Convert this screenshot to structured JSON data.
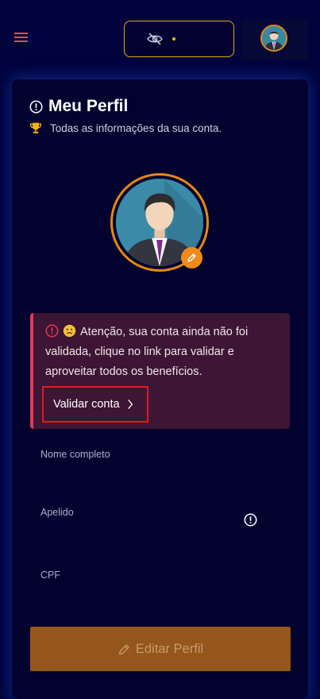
{
  "header": {
    "menu_icon": "hamburger-menu-icon",
    "balance_visibility_icon": "eye-slash-icon",
    "balance_hidden_value": "•",
    "avatar_icon": "user-avatar-icon"
  },
  "profile": {
    "title_icon": "info-circle-icon",
    "title": "Meu Perfil",
    "subtitle_icon": "trophy-icon",
    "subtitle": "Todas as informações da sua conta.",
    "edit_avatar_icon": "pencil-icon"
  },
  "alert": {
    "icons": [
      "warning-circle-icon",
      "sad-face-emoji-icon"
    ],
    "message": "Atenção, sua conta ainda não foi validada, clique no link para validar e aproveitar todos os benefícios.",
    "action_label": "Validar conta",
    "action_icon": "chevron-right-icon"
  },
  "form": {
    "fields": [
      {
        "label": "Nome completo",
        "value": ""
      },
      {
        "label": "Apelido",
        "value": "",
        "info_icon": "info-circle-icon"
      },
      {
        "label": "CPF",
        "value": ""
      }
    ]
  },
  "actions": {
    "edit_profile_label": "Editar Perfil",
    "edit_profile_icon": "pencil-icon"
  },
  "colors": {
    "background": "#01023a",
    "card": "#02022e",
    "accent_orange": "#e88814",
    "alert_background": "#3d1535",
    "alert_border": "#e03a55",
    "highlight_red": "#e21a1a",
    "edit_button": "#94561a"
  }
}
